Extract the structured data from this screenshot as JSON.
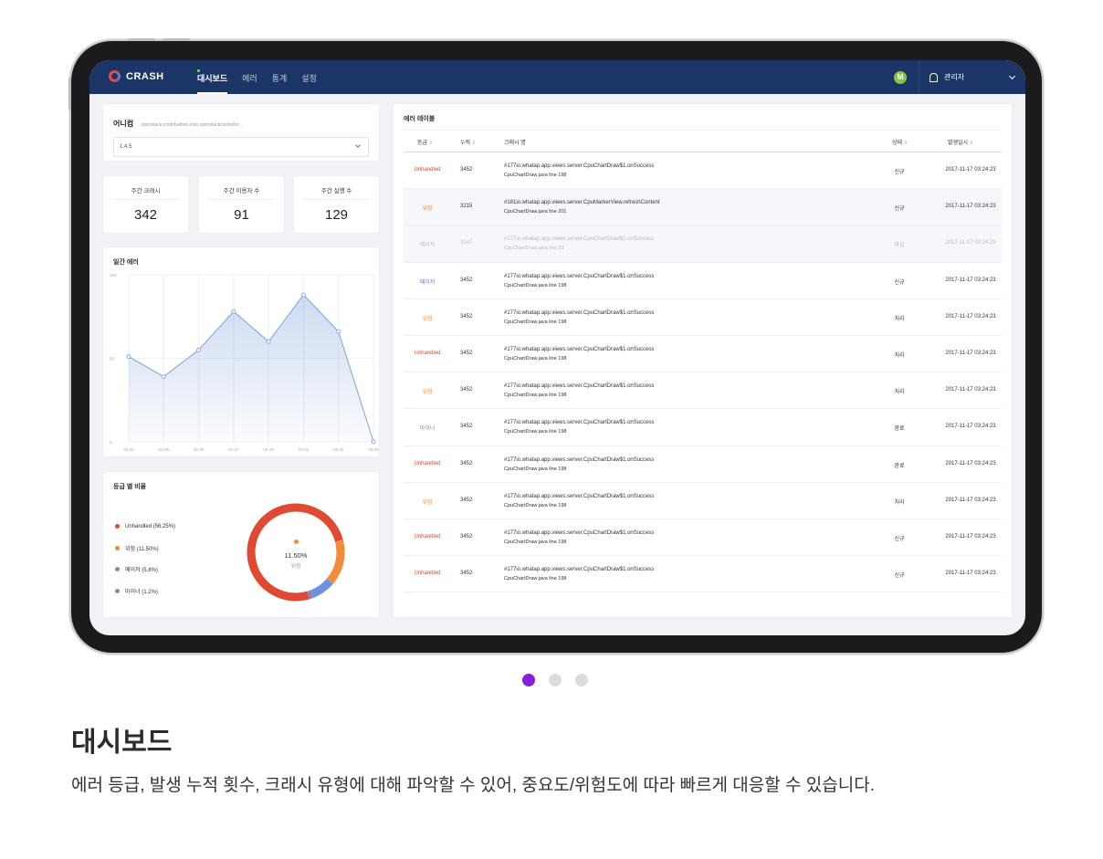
{
  "app": {
    "logo_text": "CRASH"
  },
  "nav": [
    {
      "label": "대시보드",
      "active": true
    },
    {
      "label": "에러",
      "active": false
    },
    {
      "label": "통계",
      "active": false
    },
    {
      "label": "설정",
      "active": false
    }
  ],
  "user": {
    "avatar_letter": "M",
    "role": "관리자"
  },
  "app_selector": {
    "name": "어니컴",
    "package": "openstack.contributhon.com.openstackcontroller...",
    "version": "1.4.5"
  },
  "stats": [
    {
      "label": "주간 크래시",
      "value": "342"
    },
    {
      "label": "주간 이용자 수",
      "value": "91"
    },
    {
      "label": "주간 실행 수",
      "value": "129"
    }
  ],
  "daily_errors": {
    "title": "일간 에러",
    "chart_data": {
      "type": "area",
      "x": [
        "02-24",
        "02-25",
        "02-26",
        "02-27",
        "02-28",
        "03-01",
        "03-02",
        "03-03"
      ],
      "values": [
        51,
        39,
        55,
        78,
        60,
        88,
        66,
        0
      ],
      "ylim": [
        0,
        100
      ],
      "yticks": [
        "100",
        "50",
        "0"
      ],
      "color": "#8faee0"
    }
  },
  "grade_ratio": {
    "title": "등급 별 비율",
    "center_pct": "11.50%",
    "center_label": "위험",
    "chart_data": {
      "type": "pie",
      "labels": [
        "Unhandled",
        "위험",
        "메이저",
        "마이너"
      ],
      "values": [
        56.25,
        11.5,
        5.8,
        1.2
      ],
      "legend": [
        "Unhandled (56.25%)",
        "위험 (11.50%)",
        "메이저 (5.8%)",
        "마이너 (1.2%)"
      ],
      "colors": [
        "#e04a32",
        "#f28c3b",
        "#6f8fe0",
        "#8c86b5"
      ]
    }
  },
  "error_table": {
    "title": "에러 테이블",
    "headers": {
      "grade": "등급",
      "count": "누적",
      "name": "크래시 명",
      "state": "상태",
      "date": "발생일시"
    },
    "rows": [
      {
        "grade": "Unhandled",
        "grade_color": "#e04a32",
        "count": "3452",
        "name": "#177io.whatap.app.views.server.CpuChartDraw$1.onSuccess",
        "sub": "CpuChartDraw.java line 198",
        "state": "신규",
        "date": "2017-11-17 03:24:23"
      },
      {
        "grade": "위험",
        "grade_color": "#f28c3b",
        "count": "3215",
        "name": "#181io.whatap.app.views.server.CpuMarkerView.refreshContent",
        "sub": "CpuChartDraw.java line 201",
        "state": "신규",
        "date": "2017-11-17 03:24:23"
      },
      {
        "grade": "메이저",
        "grade_color": "#b5b9c1",
        "count": "3147",
        "name": "#177io.whatap.app.views.server.CpuChartDraw$1.onSuccess",
        "sub": "CpuChartDraw.java line 93",
        "state": "마감",
        "date": "2017-11-17 03:24:23"
      },
      {
        "grade": "메이저",
        "grade_color": "#5c7fd9",
        "count": "3452",
        "name": "#177io.whatap.app.views.server.CpuChartDraw$1.onSuccess",
        "sub": "CpuChartDraw.java line 198",
        "state": "신규",
        "date": "2017-11-17 03:24:23"
      },
      {
        "grade": "위험",
        "grade_color": "#f28c3b",
        "count": "3452",
        "name": "#177io.whatap.app.views.server.CpuChartDraw$1.onSuccess",
        "sub": "CpuChartDraw.java line 198",
        "state": "처리",
        "date": "2017-11-17 03:24:23"
      },
      {
        "grade": "Unhandled",
        "grade_color": "#e04a32",
        "count": "3452",
        "name": "#177io.whatap.app.views.server.CpuChartDraw$1.onSuccess",
        "sub": "CpuChartDraw.java line 198",
        "state": "처리",
        "date": "2017-11-17 03:24:23"
      },
      {
        "grade": "위험",
        "grade_color": "#f28c3b",
        "count": "3452",
        "name": "#177io.whatap.app.views.server.CpuChartDraw$1.onSuccess",
        "sub": "CpuChartDraw.java line 198",
        "state": "처리",
        "date": "2017-11-17 03:24:23"
      },
      {
        "grade": "마이너",
        "grade_color": "#8c86b5",
        "count": "3452",
        "name": "#177io.whatap.app.views.server.CpuChartDraw$1.onSuccess",
        "sub": "CpuChartDraw.java line 198",
        "state": "완료",
        "date": "2017-11-17 03:24:23"
      },
      {
        "grade": "Unhandled",
        "grade_color": "#e04a32",
        "count": "3452",
        "name": "#177io.whatap.app.views.server.CpuChartDraw$1.onSuccess",
        "sub": "CpuChartDraw.java line 198",
        "state": "완료",
        "date": "2017-11-17 03:24:23"
      },
      {
        "grade": "위험",
        "grade_color": "#f28c3b",
        "count": "3452",
        "name": "#177io.whatap.app.views.server.CpuChartDraw$1.onSuccess",
        "sub": "CpuChartDraw.java line 198",
        "state": "처리",
        "date": "2017-11-17 03:24:23"
      },
      {
        "grade": "Unhandled",
        "grade_color": "#e04a32",
        "count": "3452",
        "name": "#177io.whatap.app.views.server.CpuChartDraw$1.onSuccess",
        "sub": "CpuChartDraw.java line 198",
        "state": "신규",
        "date": "2017-11-17 03:24:23"
      },
      {
        "grade": "Unhandled",
        "grade_color": "#e04a32",
        "count": "3452",
        "name": "#177io.whatap.app.views.server.CpuChartDraw$1.onSuccess",
        "sub": "CpuChartDraw.java line 198",
        "state": "신규",
        "date": "2017-11-17 03:24:23"
      }
    ]
  },
  "carousel": {
    "active_index": 0,
    "count": 3
  },
  "caption": {
    "title": "대시보드",
    "description": "에러 등급, 발생 누적 횟수, 크래시 유형에 대해 파악할 수 있어, 중요도/위험도에 따라 빠르게 대응할 수 있습니다."
  }
}
